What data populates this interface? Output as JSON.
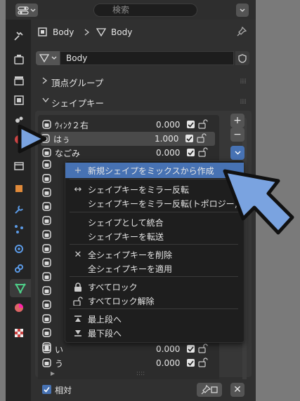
{
  "header": {
    "search_placeholder": "検索"
  },
  "breadcrumb": {
    "object": "Body",
    "mesh": "Body"
  },
  "datablock": {
    "name": "Body"
  },
  "panels": {
    "vertex_groups": "頂点グループ",
    "shape_keys": "シェイプキー"
  },
  "shape_keys": [
    {
      "name": "ｳｨﾝｸ２右",
      "value": "0.000"
    },
    {
      "name": "はぅ",
      "value": "1.000"
    },
    {
      "name": "なごみ",
      "value": "0.000"
    },
    {
      "name": "い",
      "value": "0.000"
    },
    {
      "name": "う",
      "value": "0.000"
    }
  ],
  "context_menu": {
    "items": [
      {
        "icon": "plus-icon",
        "label": "新規シェイプをミックスから作成"
      },
      {
        "icon": "mirror-icon",
        "label": "シェイプキーをミラー反転"
      },
      {
        "icon": "",
        "label": "シェイプキーをミラー反転(トポロジー)"
      },
      {
        "icon": "",
        "label": "シェイプとして統合"
      },
      {
        "icon": "",
        "label": "シェイプキーを転送"
      },
      {
        "icon": "x-icon",
        "label": "全シェイプキーを削除"
      },
      {
        "icon": "",
        "label": "全シェイプキーを適用"
      },
      {
        "icon": "lock-icon",
        "label": "すべてロック"
      },
      {
        "icon": "unlock-icon",
        "label": "すべてロック解除"
      },
      {
        "icon": "top-icon",
        "label": "最上段へ"
      },
      {
        "icon": "bottom-icon",
        "label": "最下段へ"
      }
    ]
  },
  "footer": {
    "relative_label": "相対"
  },
  "colors": {
    "highlight": "#4772b3",
    "overlay_arrow": "#7aa3e0"
  }
}
